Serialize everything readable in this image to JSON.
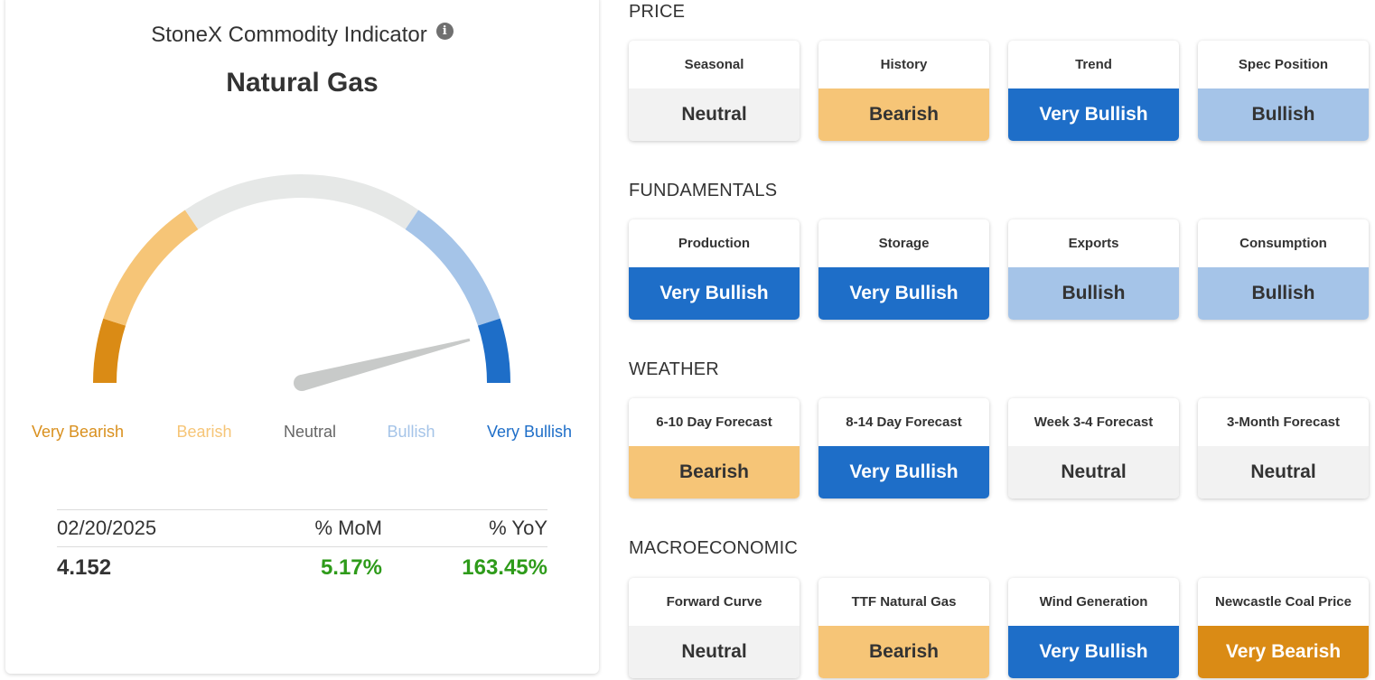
{
  "indicator": {
    "title": "StoneX Commodity Indicator",
    "info_icon": "info-icon",
    "commodity": "Natural Gas",
    "gauge": {
      "labels": [
        "Very Bearish",
        "Bearish",
        "Neutral",
        "Bullish",
        "Very Bullish"
      ],
      "label_colors": [
        "#d9901e",
        "#f6c577",
        "#666666",
        "#a5c4e8",
        "#1e6ec8"
      ],
      "segment_colors": [
        "#da8b15",
        "#f6c577",
        "#e6e8e7",
        "#a5c4e8",
        "#1e6ec8"
      ],
      "needle_level": 0.92
    },
    "stats": {
      "date": "02/20/2025",
      "mom_label": "% MoM",
      "yoy_label": "% YoY",
      "price": "4.152",
      "mom_value": "5.17%",
      "yoy_value": "163.45%"
    }
  },
  "sections": [
    {
      "title": "PRICE",
      "cards": [
        {
          "label": "Seasonal",
          "status": "Neutral",
          "level": "neutral"
        },
        {
          "label": "History",
          "status": "Bearish",
          "level": "bearish"
        },
        {
          "label": "Trend",
          "status": "Very Bullish",
          "level": "verybullish"
        },
        {
          "label": "Spec Position",
          "status": "Bullish",
          "level": "bullish"
        }
      ]
    },
    {
      "title": "FUNDAMENTALS",
      "cards": [
        {
          "label": "Production",
          "status": "Very Bullish",
          "level": "verybullish"
        },
        {
          "label": "Storage",
          "status": "Very Bullish",
          "level": "verybullish"
        },
        {
          "label": "Exports",
          "status": "Bullish",
          "level": "bullish"
        },
        {
          "label": "Consumption",
          "status": "Bullish",
          "level": "bullish"
        }
      ]
    },
    {
      "title": "WEATHER",
      "cards": [
        {
          "label": "6-10 Day Forecast",
          "status": "Bearish",
          "level": "bearish"
        },
        {
          "label": "8-14 Day Forecast",
          "status": "Very Bullish",
          "level": "verybullish"
        },
        {
          "label": "Week 3-4 Forecast",
          "status": "Neutral",
          "level": "neutral"
        },
        {
          "label": "3-Month Forecast",
          "status": "Neutral",
          "level": "neutral"
        }
      ]
    },
    {
      "title": "MACROECONOMIC",
      "cards": [
        {
          "label": "Forward Curve",
          "status": "Neutral",
          "level": "neutral"
        },
        {
          "label": "TTF Natural Gas",
          "status": "Bearish",
          "level": "bearish"
        },
        {
          "label": "Wind Generation",
          "status": "Very Bullish",
          "level": "verybullish"
        },
        {
          "label": "Newcastle Coal Price",
          "status": "Very Bearish",
          "level": "verybearish"
        }
      ]
    }
  ]
}
